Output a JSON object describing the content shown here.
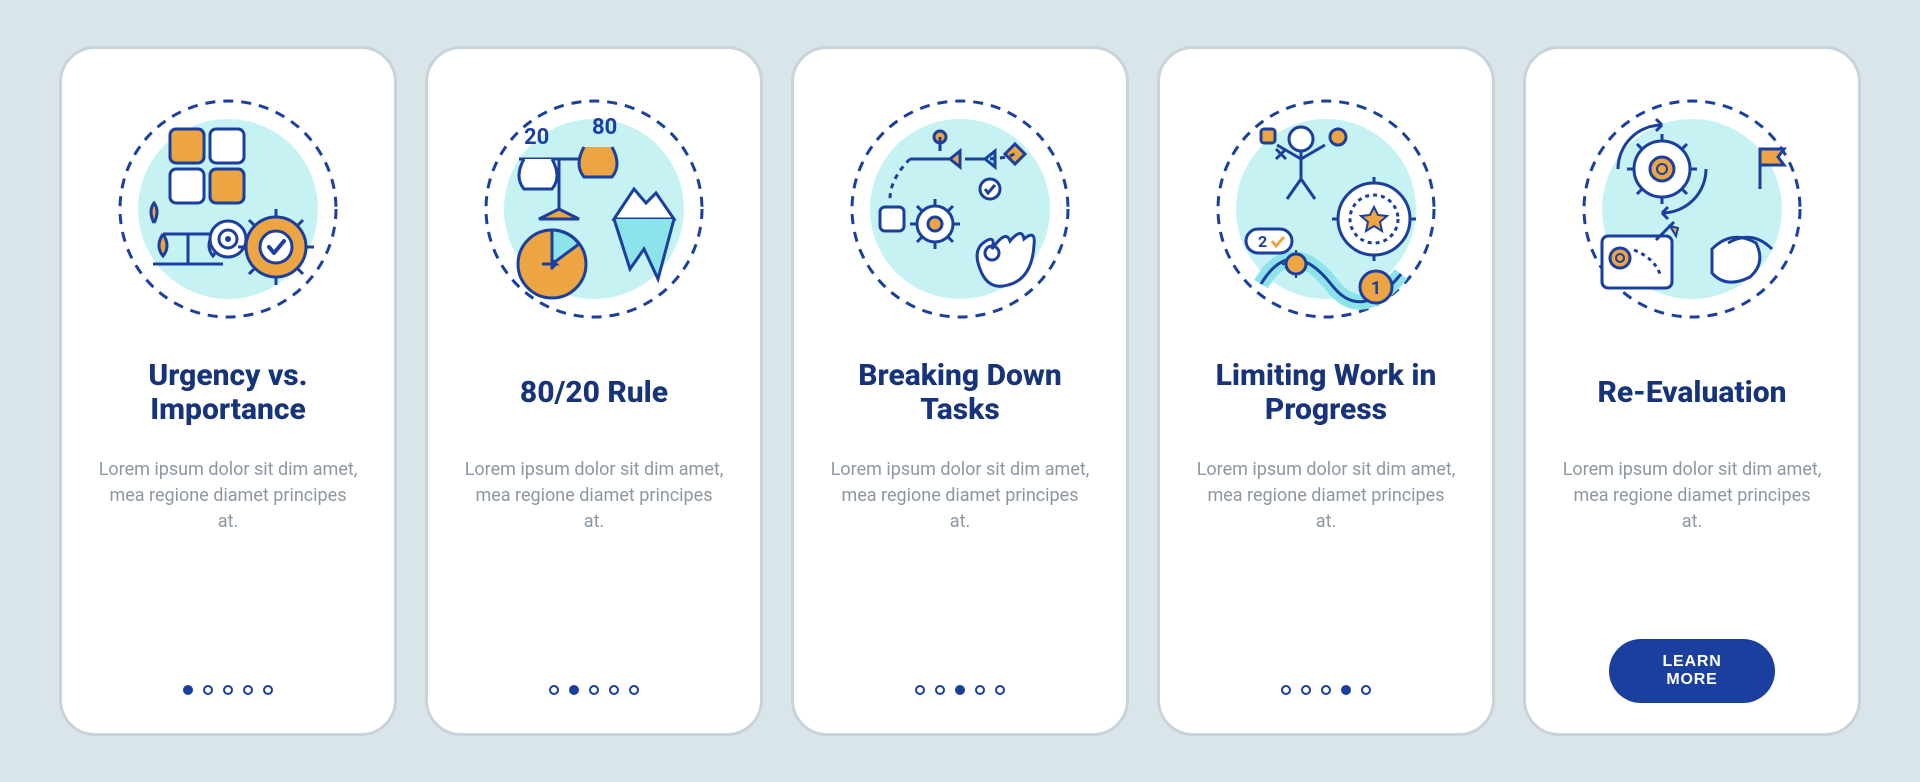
{
  "colors": {
    "bg": "#dae5ea",
    "card_border": "#c9d3db",
    "title": "#17347a",
    "desc": "#8d97a3",
    "accent_navy": "#1a3f9e",
    "accent_orange": "#eda443",
    "accent_cyan": "#8de3ea",
    "accent_cyan_light": "#c6f2f4"
  },
  "cards": [
    {
      "icon_name": "urgency-importance-illustration",
      "title": "Urgency vs. Importance",
      "desc": "Lorem ipsum dolor sit dim amet, mea regione diamet principes at.",
      "active_dot": 0
    },
    {
      "icon_name": "pareto-80-20-illustration",
      "title": "80/20 Rule",
      "desc": "Lorem ipsum dolor sit dim amet, mea regione diamet principes at.",
      "active_dot": 1,
      "badge_20": "20",
      "badge_80": "80"
    },
    {
      "icon_name": "breaking-tasks-illustration",
      "title": "Breaking Down Tasks",
      "desc": "Lorem ipsum dolor sit dim amet, mea regione diamet principes at.",
      "active_dot": 2
    },
    {
      "icon_name": "limiting-wip-illustration",
      "title": "Limiting Work in Progress",
      "desc": "Lorem ipsum dolor sit dim amet, mea regione diamet principes at.",
      "active_dot": 3,
      "badge_1": "1",
      "badge_2": "2"
    },
    {
      "icon_name": "re-evaluation-illustration",
      "title": "Re-Evaluation",
      "desc": "Lorem ipsum dolor sit dim amet, mea regione diamet principes at.",
      "cta_label": "LEARN MORE"
    }
  ]
}
